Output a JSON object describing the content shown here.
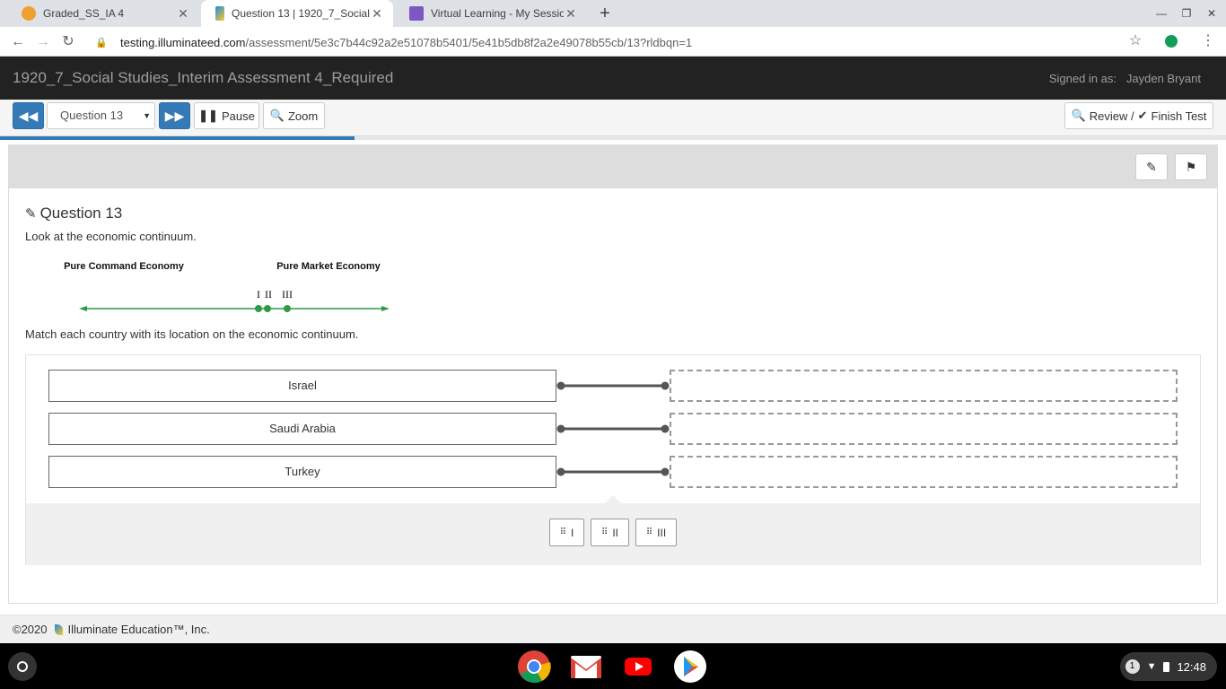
{
  "browser": {
    "tabs": [
      {
        "title": "Graded_SS_IA 4",
        "active": false
      },
      {
        "title": "Question 13 | 1920_7_Social Stu",
        "active": true
      },
      {
        "title": "Virtual Learning - My Sessions",
        "active": false
      }
    ],
    "url_host": "testing.illuminateed.com",
    "url_path": "/assessment/5e3c7b44c92a2e51078b5401/5e41b5db8f2a2e49078b55cb/13?rldbqn=1"
  },
  "header": {
    "title": "1920_7_Social Studies_Interim Assessment 4_Required",
    "signed_in_label": "Signed in as:",
    "user_name": "Jayden Bryant"
  },
  "toolbar": {
    "question_select": "Question 13",
    "pause_label": "Pause",
    "zoom_label": "Zoom",
    "review_label": "Review /",
    "finish_label": "Finish Test",
    "progress_fraction": 0.289
  },
  "question": {
    "title": "Question 13",
    "prompt": "Look at the economic continuum.",
    "instruction": "Match each country with its location on the economic continuum.",
    "continuum": {
      "left_label": "Pure Command Economy",
      "right_label": "Pure Market Economy",
      "markers": [
        "I",
        "II",
        "III"
      ],
      "line_color": "#2e9a48"
    },
    "countries": [
      "Israel",
      "Saudi Arabia",
      "Turkey"
    ],
    "answer_choices": [
      "I",
      "II",
      "III"
    ]
  },
  "footer": {
    "copyright": "©2020",
    "company": "Illuminate Education™, Inc."
  },
  "system": {
    "notification_count": "1",
    "time": "12:48"
  }
}
